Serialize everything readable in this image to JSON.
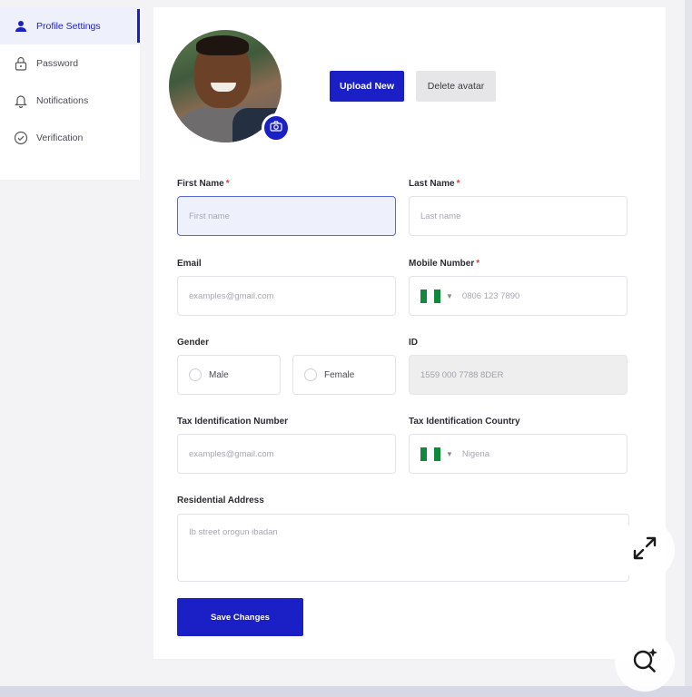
{
  "sidebar": {
    "items": [
      {
        "label": "Profile Settings",
        "icon": "user-icon",
        "active": true
      },
      {
        "label": "Password",
        "icon": "lock-icon",
        "active": false
      },
      {
        "label": "Notifications",
        "icon": "bell-icon",
        "active": false
      },
      {
        "label": "Verification",
        "icon": "check-circle-icon",
        "active": false
      }
    ]
  },
  "avatar": {
    "upload_label": "Upload New",
    "delete_label": "Delete avatar",
    "camera_icon": "camera-icon"
  },
  "form": {
    "first_name": {
      "label": "First Name",
      "required": "*",
      "placeholder": "First name"
    },
    "last_name": {
      "label": "Last Name",
      "required": "*",
      "placeholder": "Last name"
    },
    "email": {
      "label": "Email",
      "placeholder": "examples@gmail.com"
    },
    "mobile": {
      "label": "Mobile Number",
      "required": "*",
      "placeholder": "0806 123 7890",
      "country_flag": "nigeria-flag-icon"
    },
    "gender": {
      "label": "Gender",
      "options": [
        "Male",
        "Female"
      ]
    },
    "id": {
      "label": "ID",
      "value": "1559  000  7788  8DER"
    },
    "tin": {
      "label": "Tax Identification Number",
      "placeholder": "examples@gmail.com"
    },
    "tax_country": {
      "label": "Tax Identification Country",
      "value": "Nigeria",
      "country_flag": "nigeria-flag-icon"
    },
    "address": {
      "label": "Residential Address",
      "placeholder": "Ib street orogun ibadan"
    },
    "save_label": "Save Changes"
  },
  "colors": {
    "accent": "#1b1fc6",
    "required": "#e23b3b",
    "flag_green": "#0f8a3b"
  },
  "floating": {
    "expand_icon": "expand-icon",
    "search_sparkle_icon": "search-sparkle-icon"
  }
}
